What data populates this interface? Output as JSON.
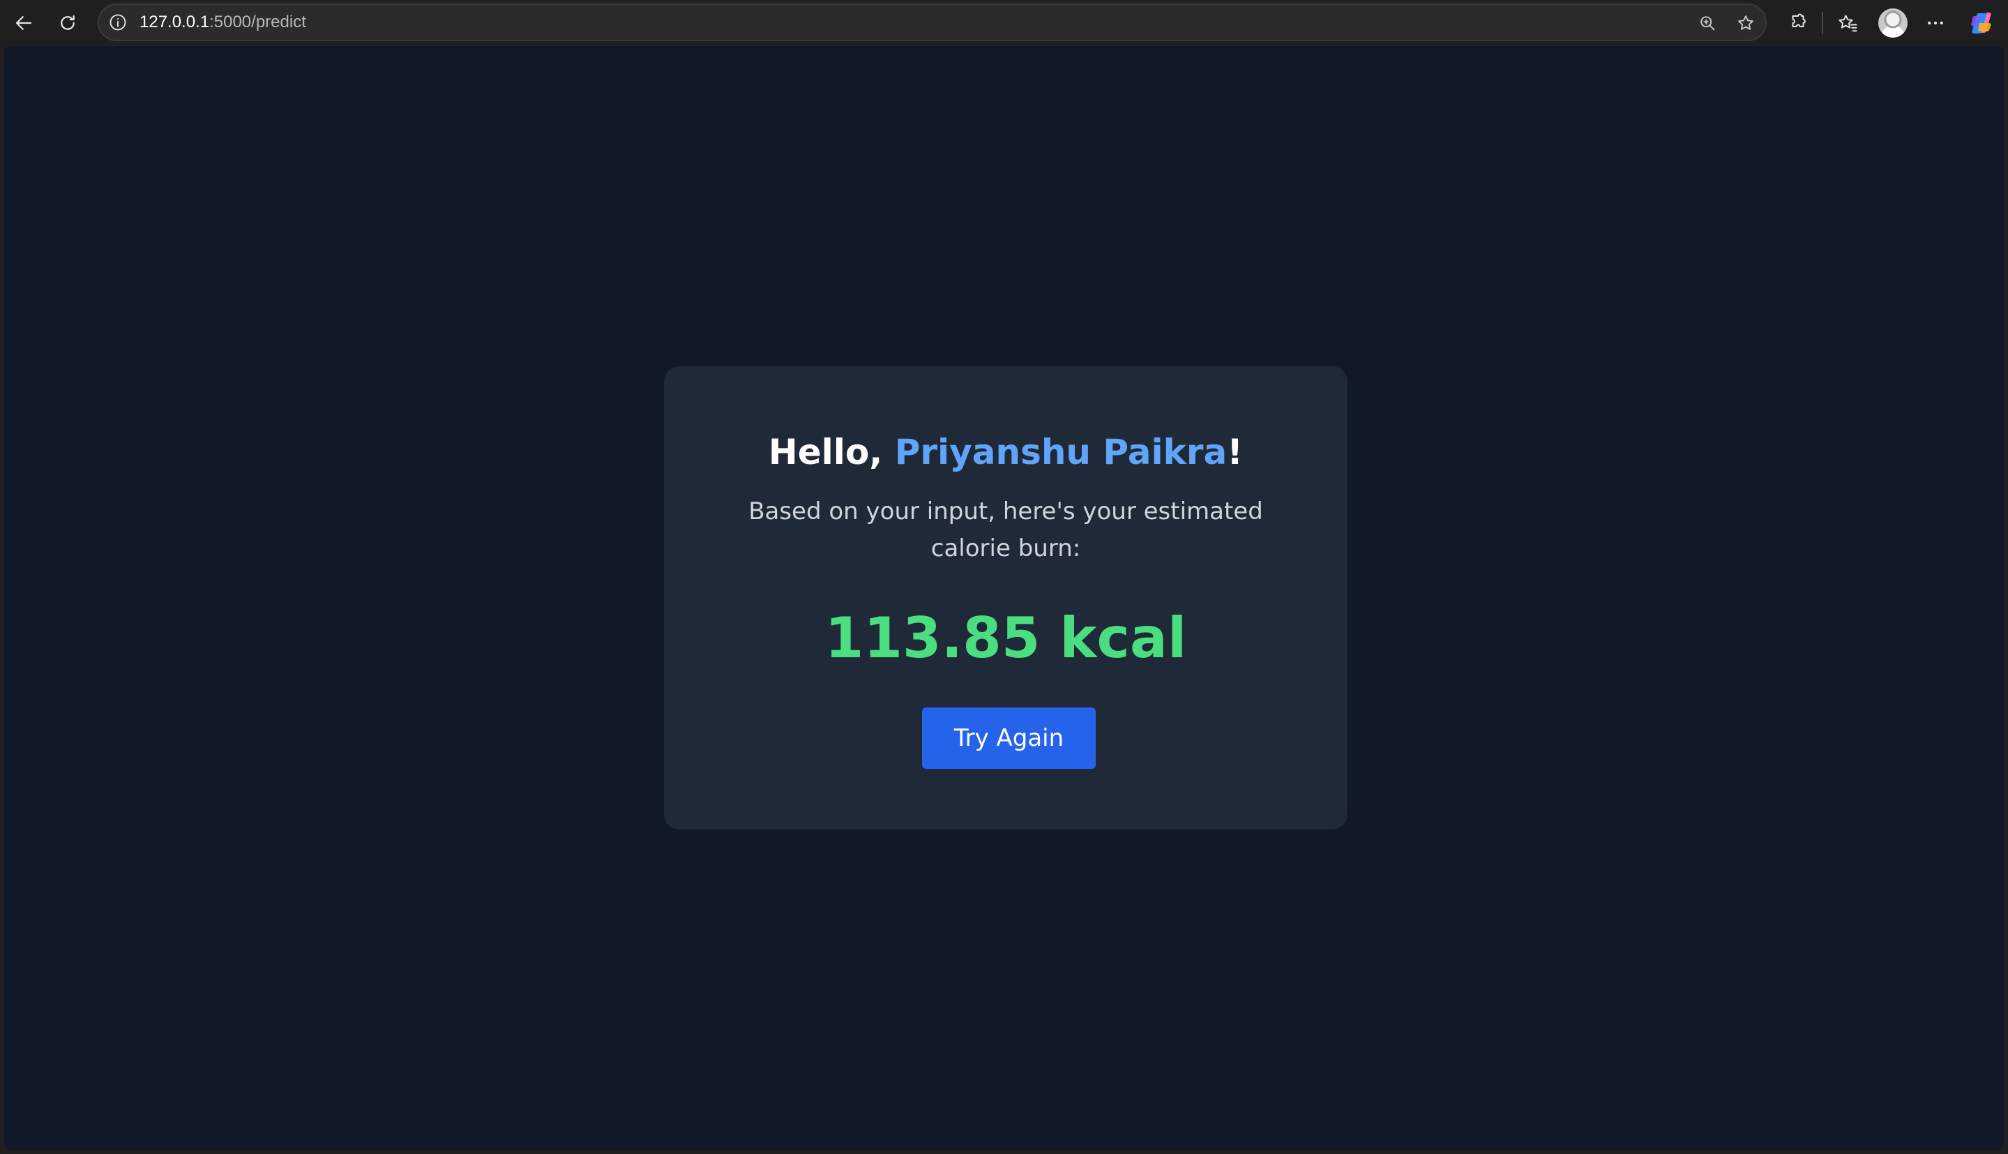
{
  "browser": {
    "url_host": "127.0.0.1",
    "url_path": ":5000/predict",
    "icons": {
      "back": "back-arrow-icon",
      "refresh": "refresh-icon",
      "site_info": "info-icon",
      "zoom": "zoom-icon",
      "favorite": "star-icon",
      "extensions": "extensions-icon",
      "favorites": "favorites-icon",
      "profile": "avatar",
      "menu": "more-icon",
      "copilot": "copilot-icon"
    }
  },
  "page": {
    "greeting_prefix": "Hello, ",
    "user_name": "Priyanshu Paikra",
    "greeting_suffix": "!",
    "subtitle": "Based on your input, here's your estimated calorie burn:",
    "result": "113.85 kcal",
    "try_again_label": "Try Again"
  },
  "colors": {
    "page_background": "#111827",
    "card_background": "#1f2937",
    "name_accent": "#60a5fa",
    "result_green": "#4ade80",
    "button_blue": "#2563eb"
  }
}
